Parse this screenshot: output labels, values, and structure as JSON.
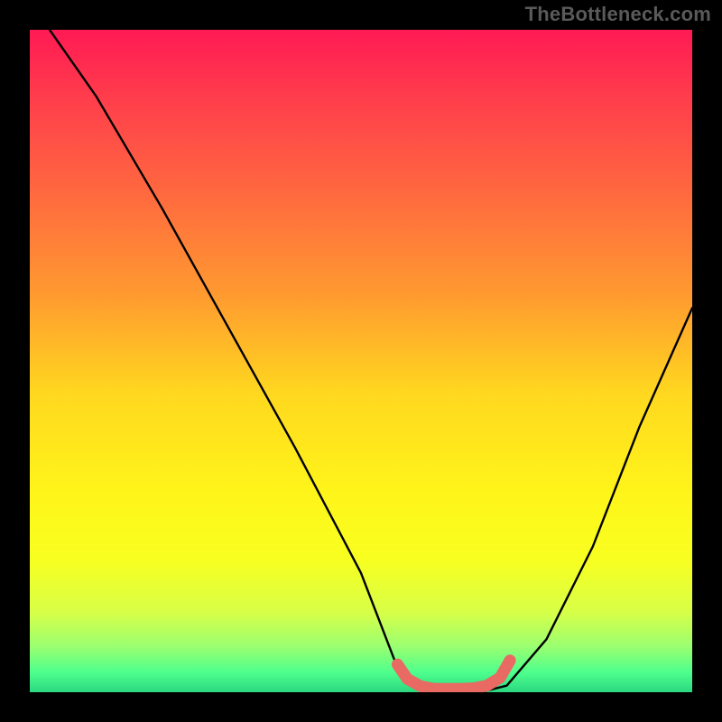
{
  "attribution": "TheBottleneck.com",
  "chart_data": {
    "type": "line",
    "title": "",
    "xlabel": "",
    "ylabel": "",
    "xlim": [
      0,
      100
    ],
    "ylim": [
      0,
      100
    ],
    "series": [
      {
        "name": "bottleneck-curve",
        "x": [
          3,
          10,
          20,
          30,
          40,
          50,
          55,
          58,
          62,
          68,
          72,
          78,
          85,
          92,
          100
        ],
        "values": [
          100,
          90,
          73,
          55,
          37,
          18,
          5,
          1,
          0,
          0,
          1,
          8,
          22,
          40,
          58
        ]
      }
    ],
    "highlight": {
      "name": "optimal-range",
      "x": [
        55.5,
        57,
        59,
        61,
        63,
        65,
        67,
        69,
        71,
        72.5
      ],
      "values": [
        4.2,
        2.0,
        0.9,
        0.5,
        0.5,
        0.5,
        0.6,
        1.0,
        2.2,
        4.8
      ]
    },
    "gradient_meaning": "red (top) = high bottleneck, green (bottom) = low bottleneck"
  }
}
